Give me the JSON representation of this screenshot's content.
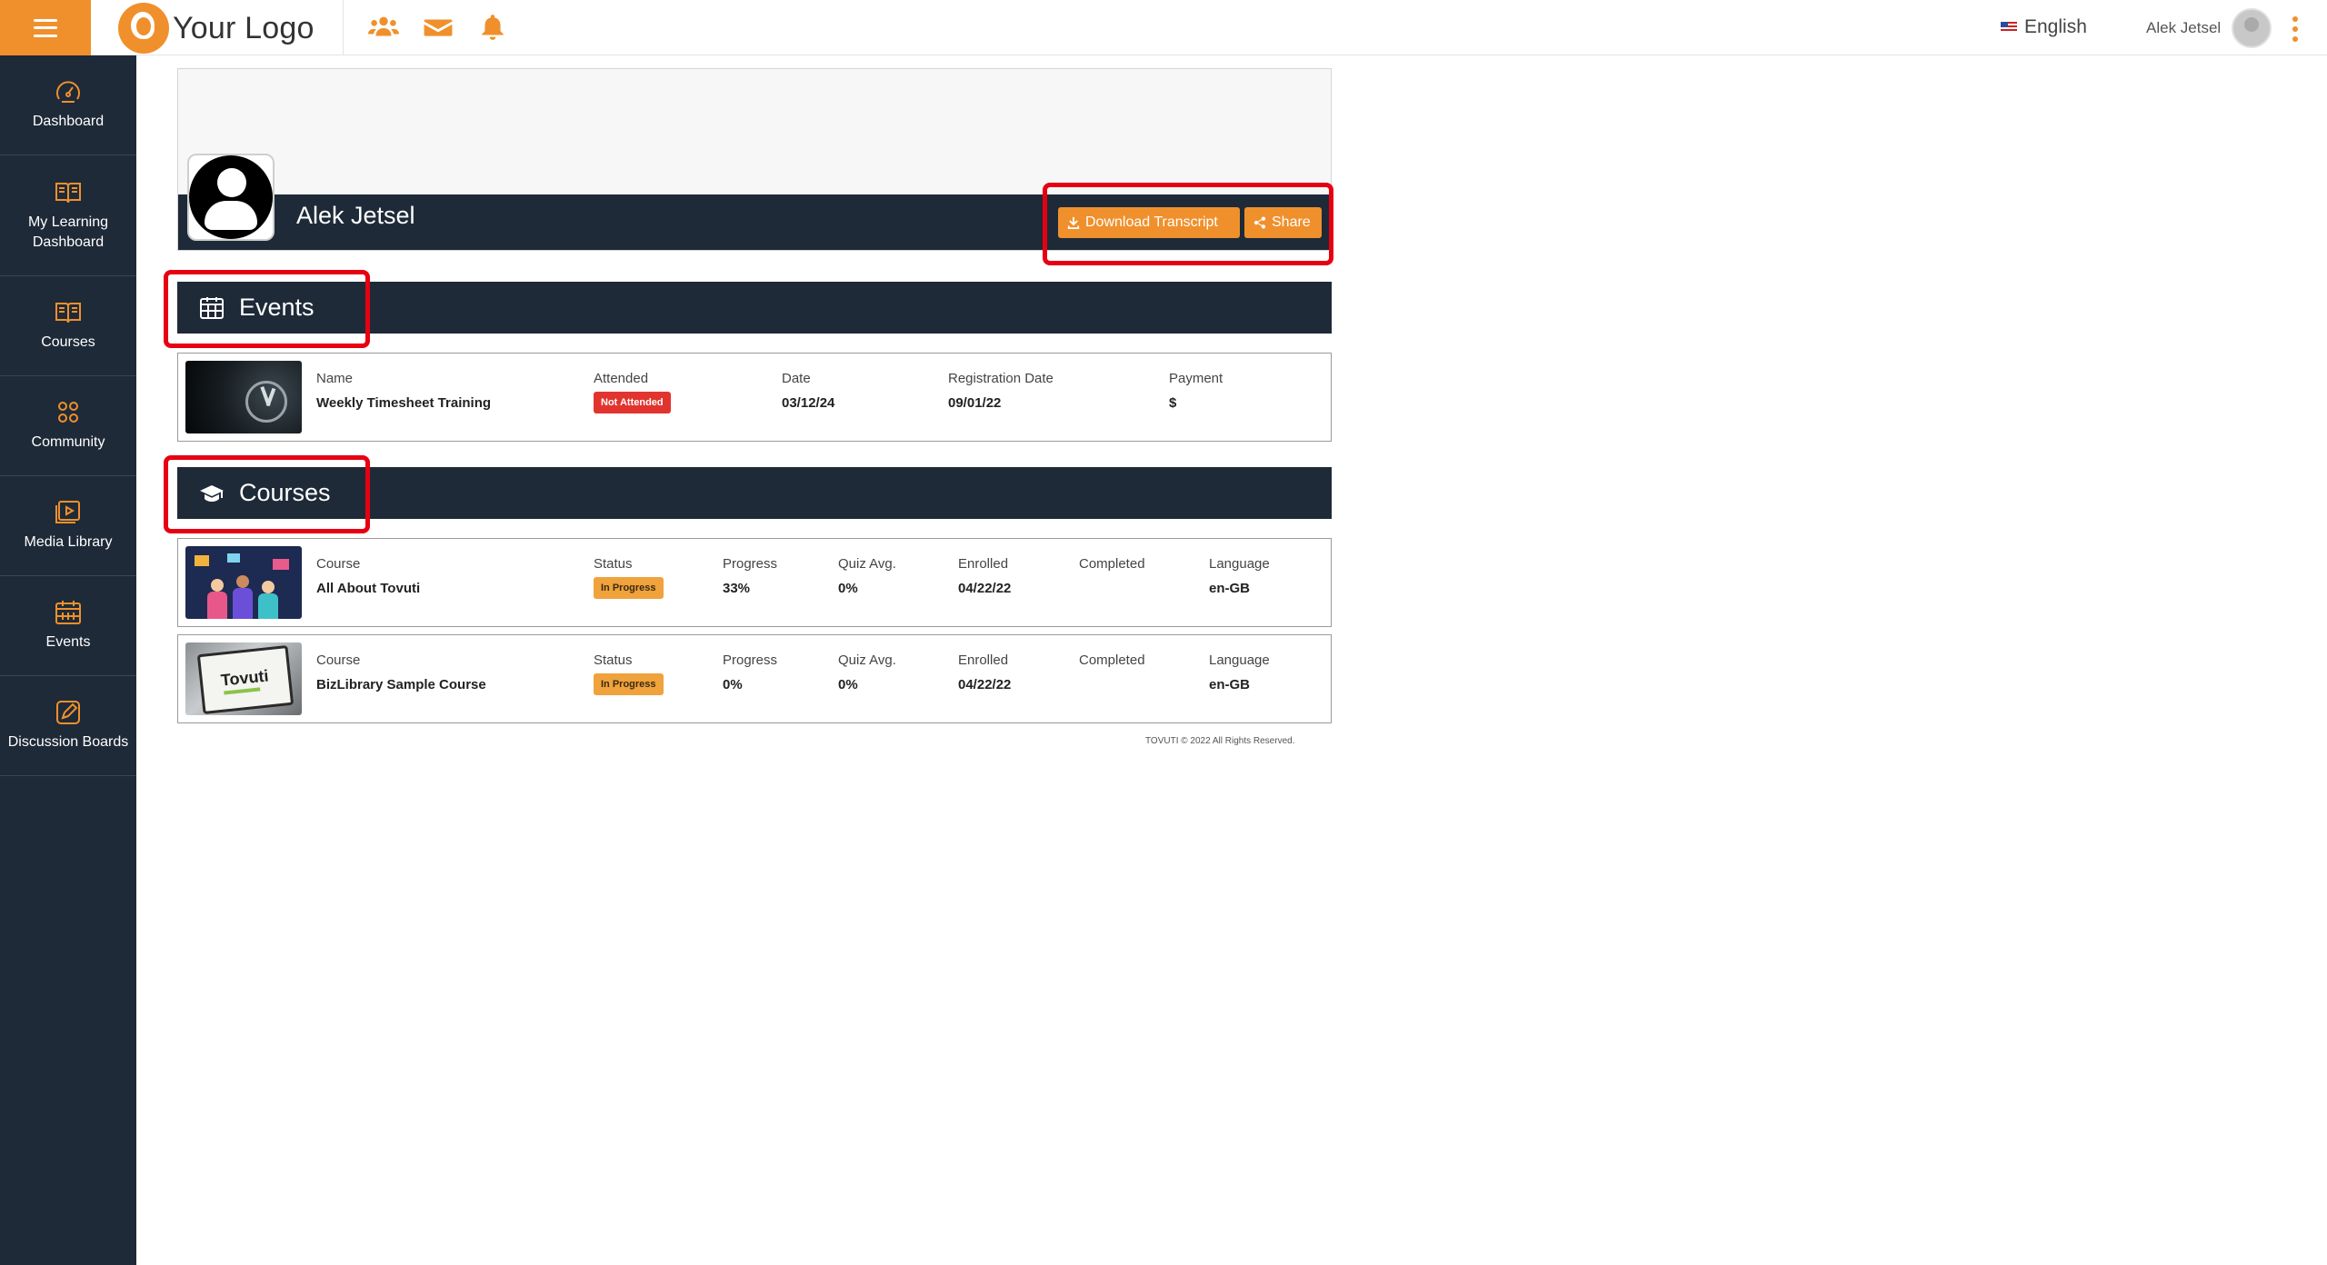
{
  "header": {
    "logo_text": "Your Logo",
    "language": "English",
    "user_name": "Alek Jetsel"
  },
  "sidebar": {
    "items": [
      {
        "label": "Dashboard",
        "icon": "gauge-icon"
      },
      {
        "label": "My Learning Dashboard",
        "icon": "open-book-icon"
      },
      {
        "label": "Courses",
        "icon": "book-icon"
      },
      {
        "label": "Community",
        "icon": "community-icon"
      },
      {
        "label": "Media Library",
        "icon": "media-library-icon"
      },
      {
        "label": "Events",
        "icon": "calendar-icon"
      },
      {
        "label": "Discussion Boards",
        "icon": "edit-pen-icon"
      }
    ]
  },
  "profile": {
    "name": "Alek Jetsel",
    "download_label": "Download Transcript",
    "share_label": "Share"
  },
  "events": {
    "title": "Events",
    "rows": [
      {
        "name_label": "Name",
        "name": "Weekly Timesheet Training",
        "attended_label": "Attended",
        "attended": "Not Attended",
        "date_label": "Date",
        "date": "03/12/24",
        "reg_label": "Registration Date",
        "reg_date": "09/01/22",
        "payment_label": "Payment",
        "payment": "$"
      }
    ]
  },
  "courses": {
    "title": "Courses",
    "rows": [
      {
        "course_label": "Course",
        "course": "All About Tovuti",
        "status_label": "Status",
        "status": "In Progress",
        "progress_label": "Progress",
        "progress": "33%",
        "quiz_label": "Quiz Avg.",
        "quiz": "0%",
        "enrolled_label": "Enrolled",
        "enrolled": "04/22/22",
        "completed_label": "Completed",
        "completed": "",
        "language_label": "Language",
        "language": "en-GB"
      },
      {
        "course_label": "Course",
        "course": "BizLibrary Sample Course",
        "status_label": "Status",
        "status": "In Progress",
        "progress_label": "Progress",
        "progress": "0%",
        "quiz_label": "Quiz Avg.",
        "quiz": "0%",
        "enrolled_label": "Enrolled",
        "enrolled": "04/22/22",
        "completed_label": "Completed",
        "completed": "",
        "language_label": "Language",
        "language": "en-GB",
        "thumb_text": "Tovuti"
      }
    ]
  },
  "footer": {
    "copyright": "TOVUTI © 2022 All Rights Reserved."
  },
  "colors": {
    "accent": "#f0902c",
    "navy": "#1e2a38",
    "highlight": "#e60012"
  }
}
